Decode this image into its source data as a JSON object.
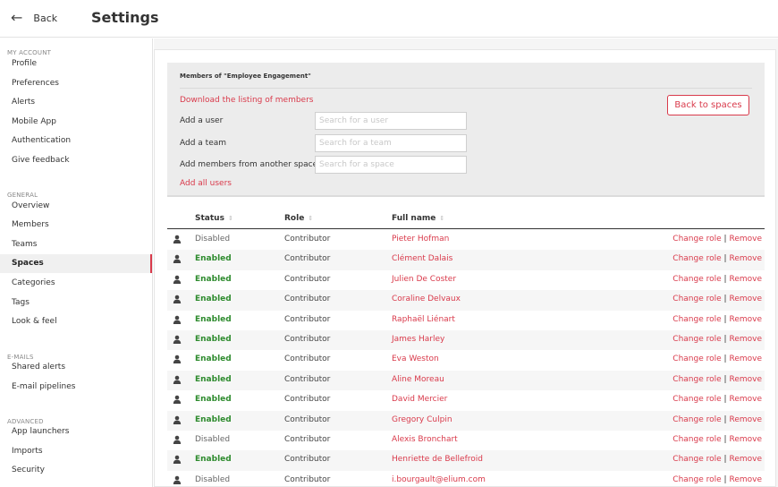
{
  "header": {
    "back_label": "Back",
    "title": "Settings"
  },
  "sidebar": {
    "sections": [
      {
        "title": "MY ACCOUNT",
        "items": [
          "Profile",
          "Preferences",
          "Alerts",
          "Mobile App",
          "Authentication",
          "Give feedback"
        ]
      },
      {
        "title": "GENERAL",
        "items": [
          "Overview",
          "Members",
          "Teams",
          "Spaces",
          "Categories",
          "Tags",
          "Look & feel"
        ]
      },
      {
        "title": "E-MAILS",
        "items": [
          "Shared alerts",
          "E-mail pipelines"
        ]
      },
      {
        "title": "ADVANCED",
        "items": [
          "App launchers",
          "Imports",
          "Security"
        ]
      }
    ],
    "active_item": "Spaces"
  },
  "panel": {
    "title": "Members of \"Employee Engagement\"",
    "download_link": "Download the listing of members",
    "add_user_label": "Add a user",
    "add_user_placeholder": "Search for a user",
    "add_team_label": "Add a team",
    "add_team_placeholder": "Search for a team",
    "add_space_label": "Add members from another space",
    "add_space_placeholder": "Search for a space",
    "add_all": "Add all users",
    "back_button": "Back to spaces"
  },
  "table": {
    "columns": [
      "Status",
      "Role",
      "Full name"
    ],
    "change_role": "Change role",
    "separator": "|",
    "remove": "Remove",
    "rows": [
      {
        "status": "Disabled",
        "role": "Contributor",
        "name": "Pieter Hofman"
      },
      {
        "status": "Enabled",
        "role": "Contributor",
        "name": "Clément Dalais"
      },
      {
        "status": "Enabled",
        "role": "Contributor",
        "name": "Julien De Coster"
      },
      {
        "status": "Enabled",
        "role": "Contributor",
        "name": "Coraline Delvaux"
      },
      {
        "status": "Enabled",
        "role": "Contributor",
        "name": "Raphaël Liénart"
      },
      {
        "status": "Enabled",
        "role": "Contributor",
        "name": "James Harley"
      },
      {
        "status": "Enabled",
        "role": "Contributor",
        "name": "Eva Weston"
      },
      {
        "status": "Enabled",
        "role": "Contributor",
        "name": "Aline Moreau"
      },
      {
        "status": "Enabled",
        "role": "Contributor",
        "name": "David Mercier"
      },
      {
        "status": "Enabled",
        "role": "Contributor",
        "name": "Gregory Culpin"
      },
      {
        "status": "Disabled",
        "role": "Contributor",
        "name": "Alexis Bronchart"
      },
      {
        "status": "Enabled",
        "role": "Contributor",
        "name": "Henriette de Bellefroid"
      },
      {
        "status": "Disabled",
        "role": "Contributor",
        "name": "i.bourgault@elium.com"
      }
    ]
  },
  "colors": {
    "accent": "#d93a4b",
    "enabled": "#2e8b2e"
  },
  "icons": {
    "back": "arrow-left-icon",
    "user": "person-icon",
    "sort": "sort-icon"
  }
}
